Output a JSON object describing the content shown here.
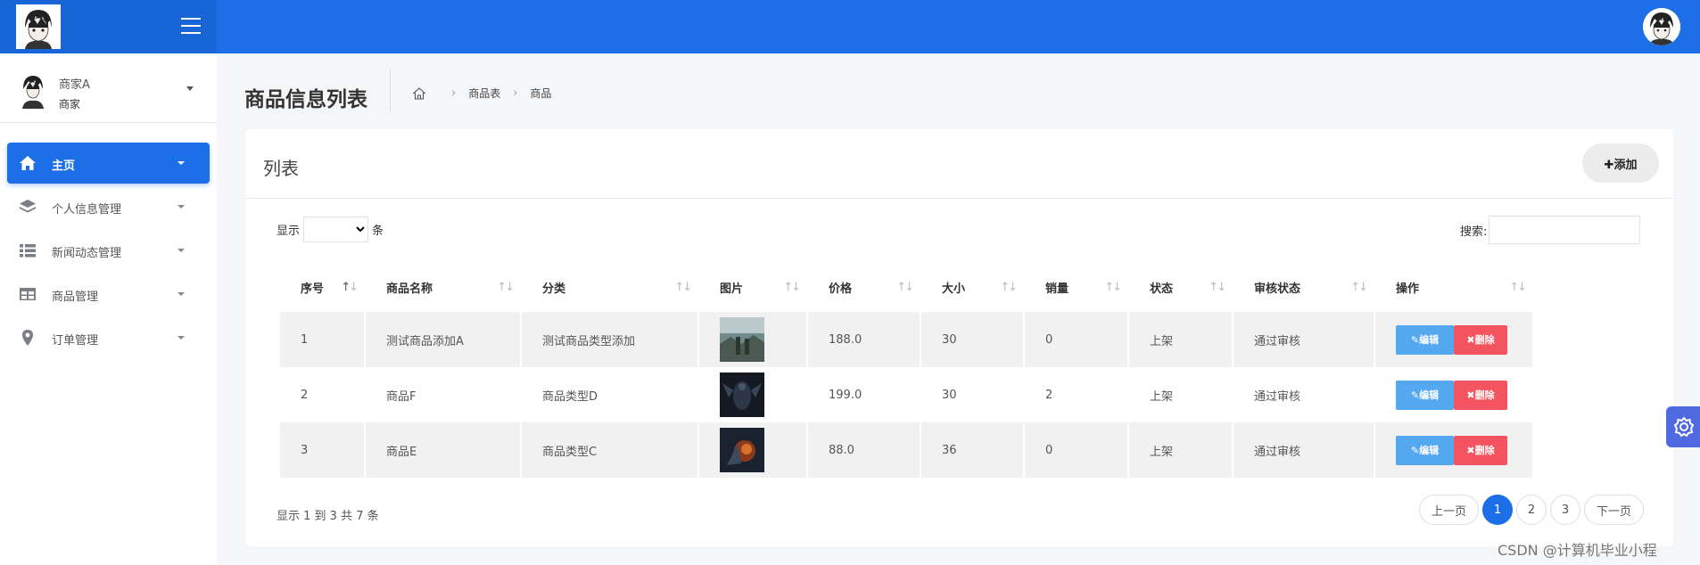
{
  "header": {
    "logo_icon": "anime-avatar-logo",
    "menu_icon": "hamburger-menu-icon",
    "avatar_icon": "anime-avatar"
  },
  "sidebar": {
    "user": {
      "name": "商家A",
      "role": "商家"
    },
    "items": [
      {
        "label": "主页",
        "icon": "home-icon",
        "active": true
      },
      {
        "label": "个人信息管理",
        "icon": "layers-icon",
        "active": false
      },
      {
        "label": "新闻动态管理",
        "icon": "list-icon",
        "active": false
      },
      {
        "label": "商品管理",
        "icon": "table-icon",
        "active": false
      },
      {
        "label": "订单管理",
        "icon": "map-pin-icon",
        "active": false
      }
    ]
  },
  "page": {
    "title": "商品信息列表",
    "breadcrumb": [
      "商品表",
      "商品"
    ]
  },
  "card": {
    "title": "列表",
    "add_label": "添加",
    "length_prefix": "显示",
    "length_suffix": "条",
    "search_label": "搜索:",
    "columns": [
      "序号",
      "商品名称",
      "分类",
      "图片",
      "价格",
      "大小",
      "销量",
      "状态",
      "审核状态",
      "操作"
    ],
    "rows": [
      {
        "no": "1",
        "name": "测试商品添加A",
        "category": "测试商品类型添加",
        "price": "188.0",
        "size": "30",
        "sales": "0",
        "status": "上架",
        "audit": "通过审核"
      },
      {
        "no": "2",
        "name": "商品F",
        "category": "商品类型D",
        "price": "199.0",
        "size": "30",
        "sales": "2",
        "status": "上架",
        "audit": "通过审核"
      },
      {
        "no": "3",
        "name": "商品E",
        "category": "商品类型C",
        "price": "88.0",
        "size": "36",
        "sales": "0",
        "status": "上架",
        "audit": "通过审核"
      }
    ],
    "edit_label": "编辑",
    "delete_label": "删除",
    "info_text": "显示 1 到 3 共 7 条",
    "pager": {
      "prev": "上一页",
      "pages": [
        "1",
        "2",
        "3"
      ],
      "current": "1",
      "next": "下一页"
    }
  },
  "watermark": "CSDN @计算机毕业小程",
  "colors": {
    "primary": "#1c6fe6",
    "edit": "#54a8ef",
    "delete": "#f3545f",
    "fab": "#4f6ae0"
  }
}
